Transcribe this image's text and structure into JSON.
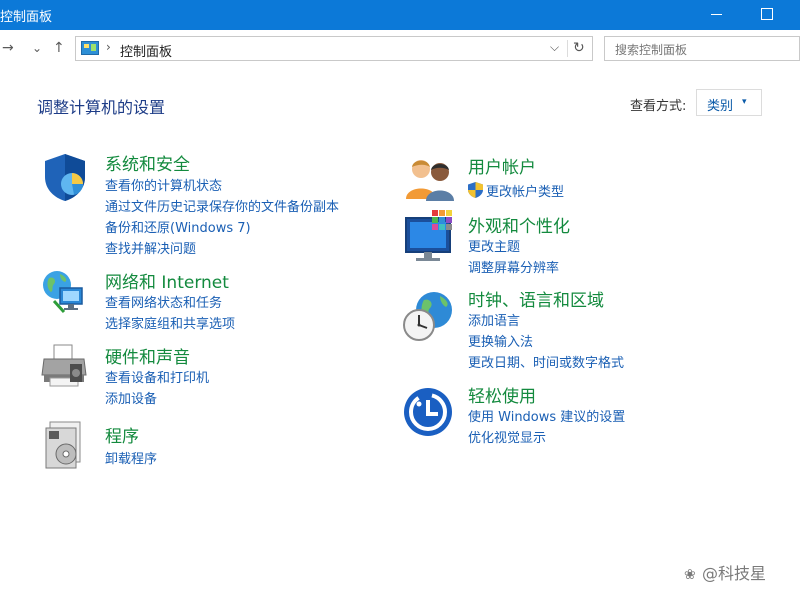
{
  "window": {
    "title": "控制面板"
  },
  "nav": {
    "forward_icon": "→",
    "recent_icon": "⌄",
    "up_icon": "↑",
    "breadcrumb_separator": "›",
    "breadcrumb": "控制面板",
    "dropdown_icon": "⌵",
    "refresh_icon": "↻",
    "search_placeholder": "搜索控制面板"
  },
  "header": {
    "title": "调整计算机的设置",
    "view_label": "查看方式:",
    "view_value": "类别",
    "view_arrow": "▾"
  },
  "categories": [
    {
      "title": "系统和安全",
      "icon": "shield-icon",
      "links": [
        "查看你的计算机状态",
        "通过文件历史记录保存你的文件备份副本",
        "备份和还原(Windows 7)",
        "查找并解决问题"
      ]
    },
    {
      "title": "网络和 Internet",
      "icon": "network-globe-icon",
      "links": [
        "查看网络状态和任务",
        "选择家庭组和共享选项"
      ]
    },
    {
      "title": "硬件和声音",
      "icon": "printer-icon",
      "links": [
        "查看设备和打印机",
        "添加设备"
      ]
    },
    {
      "title": "程序",
      "icon": "programs-disc-icon",
      "links": [
        "卸载程序"
      ]
    },
    {
      "title": "用户帐户",
      "icon": "users-icon",
      "links": [
        "更改帐户类型"
      ]
    },
    {
      "title": "外观和个性化",
      "icon": "monitor-palette-icon",
      "links": [
        "更改主题",
        "调整屏幕分辨率"
      ]
    },
    {
      "title": "时钟、语言和区域",
      "icon": "clock-globe-icon",
      "links": [
        "添加语言",
        "更换输入法",
        "更改日期、时间或数字格式"
      ]
    },
    {
      "title": "轻松使用",
      "icon": "ease-of-access-icon",
      "links": [
        "使用 Windows 建议的设置",
        "优化视觉显示"
      ]
    }
  ],
  "watermark": {
    "text": "@科技星"
  },
  "colors": {
    "titlebar": "#0c79d8",
    "category_title": "#138a3e",
    "link": "#1a5fb4",
    "page_title": "#1d3c87"
  }
}
